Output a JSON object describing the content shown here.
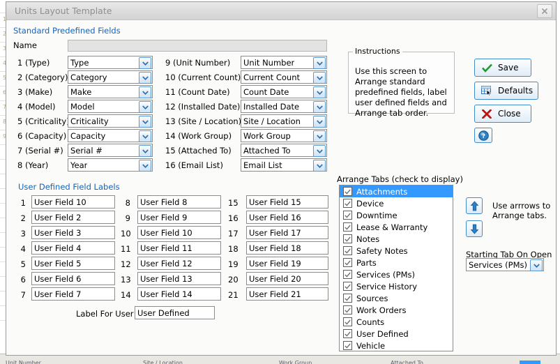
{
  "window": {
    "title": "Units Layout Template",
    "close_icon": "close-x-icon"
  },
  "standard_fields": {
    "section_label": "Standard Predefined Fields",
    "name_header": "Name",
    "left": [
      {
        "label": "1 (Type)",
        "value": "Type"
      },
      {
        "label": "2 (Category)",
        "value": "Category"
      },
      {
        "label": "3 (Make)",
        "value": "Make"
      },
      {
        "label": "4 (Model)",
        "value": "Model"
      },
      {
        "label": "5 (Criticality)",
        "value": "Criticality"
      },
      {
        "label": "6 (Capacity)",
        "value": "Capacity"
      },
      {
        "label": "7 (Serial #)",
        "value": "Serial #"
      },
      {
        "label": "8 (Year)",
        "value": "Year"
      }
    ],
    "right": [
      {
        "label": "9 (Unit Number)",
        "value": "Unit Number"
      },
      {
        "label": "10 (Current Count)",
        "value": "Current Count"
      },
      {
        "label": "11 (Count Date)",
        "value": "Count Date"
      },
      {
        "label": "12 (Installed Date)",
        "value": "Installed Date"
      },
      {
        "label": "13 (Site / Location))",
        "value": "Site / Location"
      },
      {
        "label": "14 (Work Group)",
        "value": "Work Group"
      },
      {
        "label": "15 (Attached To)",
        "value": "Attached To"
      },
      {
        "label": "16 (Email List)",
        "value": "Email List"
      }
    ]
  },
  "user_defined": {
    "section_label": "User Defined Field Labels",
    "col1": [
      {
        "num": "1",
        "value": "User Field 10"
      },
      {
        "num": "2",
        "value": "User Field 2"
      },
      {
        "num": "3",
        "value": "User Field 3"
      },
      {
        "num": "4",
        "value": "User Field 4"
      },
      {
        "num": "5",
        "value": "User Field 5"
      },
      {
        "num": "6",
        "value": "User Field 6"
      },
      {
        "num": "7",
        "value": "User Field 7"
      }
    ],
    "col2": [
      {
        "num": "8",
        "value": "User Field 8"
      },
      {
        "num": "9",
        "value": "User Field 9"
      },
      {
        "num": "10",
        "value": "User Field 10"
      },
      {
        "num": "11",
        "value": "User Field 11"
      },
      {
        "num": "12",
        "value": "User Field 12"
      },
      {
        "num": "13",
        "value": "User Field 13"
      },
      {
        "num": "14",
        "value": "User Field 14"
      }
    ],
    "col3": [
      {
        "num": "15",
        "value": "User Field 15"
      },
      {
        "num": "16",
        "value": "User Field 16"
      },
      {
        "num": "17",
        "value": "User Field 17"
      },
      {
        "num": "18",
        "value": "User Field 18"
      },
      {
        "num": "19",
        "value": "User Field 19"
      },
      {
        "num": "20",
        "value": "User Field 20"
      },
      {
        "num": "21",
        "value": "User Field 21"
      }
    ],
    "tab_label_caption": "Label For User Defined Tab",
    "tab_label_value": "User Defined"
  },
  "instructions": {
    "legend": "Instructions",
    "body": "Use this screen to Arrange standard predefined fields, label user defined fields and Arrange tab order."
  },
  "buttons": {
    "save": {
      "label": "Save",
      "icon": "green-check-icon"
    },
    "defaults": {
      "label": "Defaults",
      "icon": "grid-cursor-icon"
    },
    "close": {
      "label": "Close",
      "icon": "red-x-icon"
    },
    "help": {
      "icon": "help-question-icon"
    }
  },
  "arrange_tabs": {
    "label": "Arrange Tabs (check to display)",
    "items": [
      {
        "label": "Attachments",
        "checked": true,
        "selected": true
      },
      {
        "label": "Device",
        "checked": true,
        "selected": false
      },
      {
        "label": "Downtime",
        "checked": true,
        "selected": false
      },
      {
        "label": "Lease & Warranty",
        "checked": true,
        "selected": false
      },
      {
        "label": "Notes",
        "checked": true,
        "selected": false
      },
      {
        "label": "Safety Notes",
        "checked": true,
        "selected": false
      },
      {
        "label": "Parts",
        "checked": true,
        "selected": false
      },
      {
        "label": "Services (PMs)",
        "checked": true,
        "selected": false
      },
      {
        "label": "Service History",
        "checked": true,
        "selected": false
      },
      {
        "label": "Sources",
        "checked": true,
        "selected": false
      },
      {
        "label": "Work Orders",
        "checked": true,
        "selected": false
      },
      {
        "label": "Counts",
        "checked": true,
        "selected": false
      },
      {
        "label": "User Defined",
        "checked": true,
        "selected": false
      },
      {
        "label": "Vehicle",
        "checked": true,
        "selected": false
      }
    ],
    "arrow_hint": "Use arrrows to Arrange tabs.",
    "up_icon": "arrow-up-icon",
    "down_icon": "arrow-down-icon",
    "starting_tab_label": "Starting Tab On Open",
    "starting_tab_value": "Services (PMs)"
  },
  "colors": {
    "accent_blue": "#1763b8",
    "selection_blue": "#3399ff",
    "save_green": "#1f9a2e",
    "close_red": "#c01111"
  }
}
